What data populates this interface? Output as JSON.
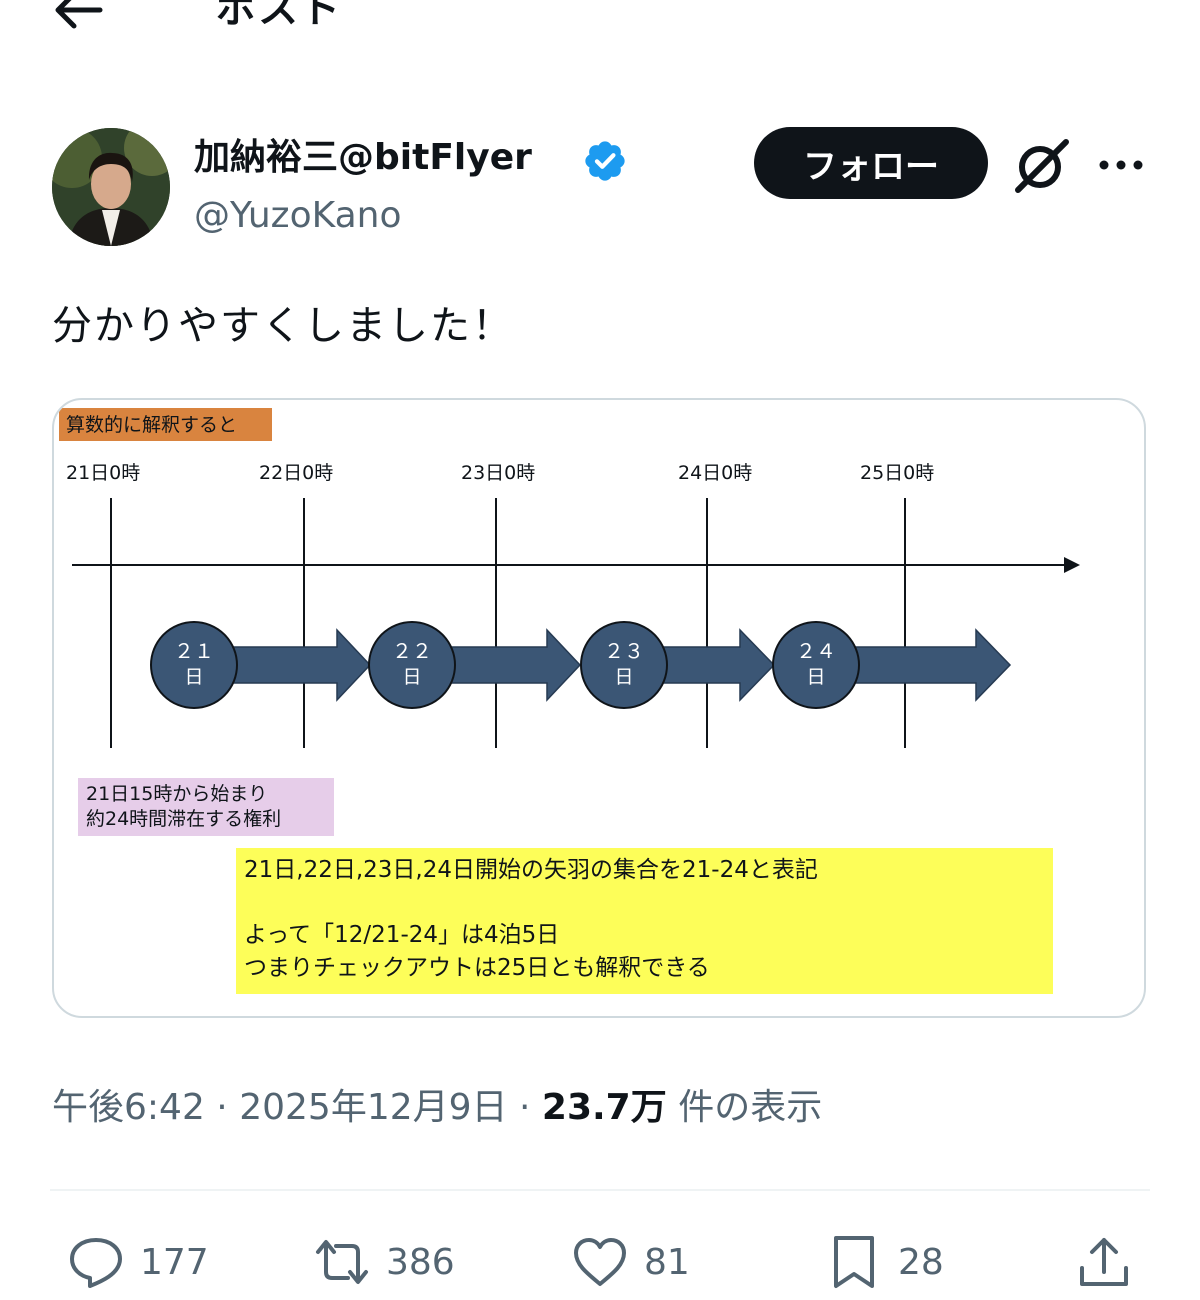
{
  "header": {
    "title": "ポスト",
    "back_icon": "arrow-left-icon"
  },
  "author": {
    "display_name": "加納裕三@bitFlyer",
    "handle": "@YuzoKano",
    "verified": true,
    "verified_color": "#1d9bf0",
    "follow_label": "フォロー"
  },
  "post": {
    "text": "分かりやすくしました！",
    "time": "午後6:42",
    "date": "2025年12月9日",
    "views_count": "23.7万",
    "views_label": "件の表示"
  },
  "diagram": {
    "header_label": "算数的に解釈すると",
    "day_labels": [
      "21日0時",
      "22日0時",
      "23日0時",
      "24日0時",
      "25日0時"
    ],
    "circles": [
      {
        "num": "２１",
        "unit": "日"
      },
      {
        "num": "２２",
        "unit": "日"
      },
      {
        "num": "２３",
        "unit": "日"
      },
      {
        "num": "２４",
        "unit": "日"
      }
    ],
    "note_pink": [
      "21日15時から始まり",
      "約24時間滞在する権利"
    ],
    "note_yellow": [
      "21日,22日,23日,24日開始の矢羽の集合を21-24と表記",
      "よって「12/21-24」は4泊5日",
      "つまりチェックアウトは25日とも解釈できる"
    ],
    "colors": {
      "arrow": "#3b5675",
      "header_bg": "#d9843f",
      "pink_bg": "#e6cde9",
      "yellow_bg": "#fdfe59"
    }
  },
  "actions": {
    "replies": "177",
    "reposts": "386",
    "likes": "81",
    "bookmarks": "28"
  }
}
